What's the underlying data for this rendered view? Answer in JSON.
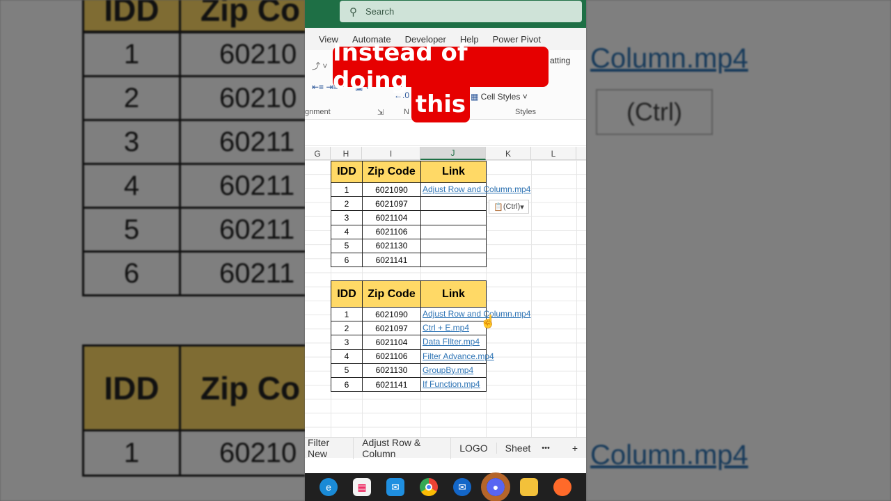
{
  "search": {
    "placeholder": "Search"
  },
  "ribbon_tabs": [
    "View",
    "Automate",
    "Developer",
    "Help",
    "Power Pivot"
  ],
  "ribbon": {
    "conditional_formatting": "atting",
    "cell_styles": "Cell Styles",
    "alignment_group": "gnment",
    "number_group": "N",
    "styles_group": "Styles"
  },
  "columns": [
    "G",
    "H",
    "I",
    "J",
    "K",
    "L"
  ],
  "table_headers": [
    "IDD",
    "Zip Code",
    "Link"
  ],
  "table1": {
    "rows": [
      [
        "1",
        "6021090",
        "Adjust Row and Column.mp4"
      ],
      [
        "2",
        "6021097",
        ""
      ],
      [
        "3",
        "6021104",
        ""
      ],
      [
        "4",
        "6021106",
        ""
      ],
      [
        "5",
        "6021130",
        ""
      ],
      [
        "6",
        "6021141",
        ""
      ]
    ]
  },
  "table2": {
    "rows": [
      [
        "1",
        "6021090",
        "Adjust Row and Column.mp4"
      ],
      [
        "2",
        "6021097",
        "Ctrl + E.mp4"
      ],
      [
        "3",
        "6021104",
        "Data FIlter.mp4"
      ],
      [
        "4",
        "6021106",
        "Filter Advance.mp4"
      ],
      [
        "5",
        "6021130",
        "GroupBy.mp4"
      ],
      [
        "6",
        "6021141",
        "If Function.mp4"
      ]
    ]
  },
  "paste_options": "(Ctrl)",
  "sheet_tabs": [
    "Filter New",
    "Adjust Row & Column",
    "LOGO",
    "Sheet"
  ],
  "sheet_more": "•••",
  "sheet_add": "+",
  "taskbar": [
    "edge",
    "store",
    "mail",
    "chrome",
    "thunderbird",
    "discord",
    "files",
    "firefox"
  ],
  "caption": {
    "line1": "Instead of doing",
    "line2": "this"
  },
  "background": {
    "left_headers": [
      "IDD",
      "Zip Co"
    ],
    "left_ids": [
      "1",
      "2",
      "3",
      "4",
      "5",
      "6"
    ],
    "left_zips": [
      "60210",
      "60210",
      "60211",
      "60211",
      "60211",
      "60211"
    ],
    "right_link": "Column.mp4",
    "right_paste": "(Ctrl)"
  }
}
